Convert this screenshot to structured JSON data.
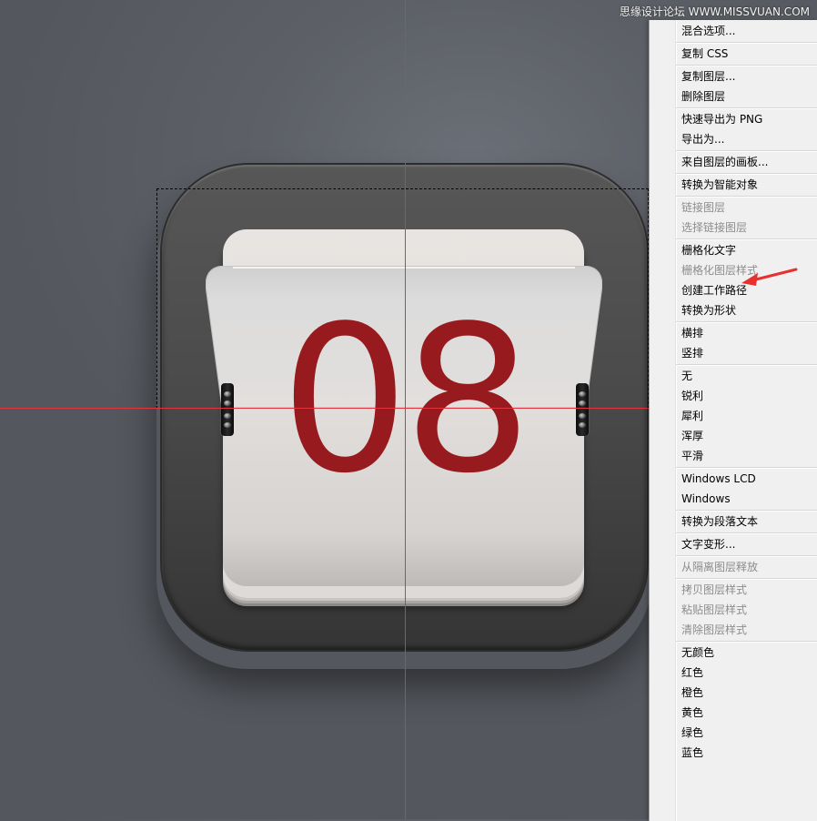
{
  "watermark": "思缘设计论坛 WWW.MISSVUAN.COM",
  "icon": {
    "digits": "08",
    "digit_color": "#971b1e"
  },
  "guides": {
    "color": "#e0343f"
  },
  "context_menu": {
    "groups": [
      [
        {
          "label": "混合选项...",
          "enabled": true
        }
      ],
      [
        {
          "label": "复制 CSS",
          "enabled": true
        }
      ],
      [
        {
          "label": "复制图层...",
          "enabled": true
        },
        {
          "label": "删除图层",
          "enabled": true
        }
      ],
      [
        {
          "label": "快速导出为 PNG",
          "enabled": true
        },
        {
          "label": "导出为...",
          "enabled": true
        }
      ],
      [
        {
          "label": "来自图层的画板...",
          "enabled": true
        }
      ],
      [
        {
          "label": "转换为智能对象",
          "enabled": true
        }
      ],
      [
        {
          "label": "链接图层",
          "enabled": false
        },
        {
          "label": "选择链接图层",
          "enabled": false
        }
      ],
      [
        {
          "label": "栅格化文字",
          "enabled": true
        },
        {
          "label": "栅格化图层样式",
          "enabled": false
        },
        {
          "label": "创建工作路径",
          "enabled": true
        },
        {
          "label": "转换为形状",
          "enabled": true
        }
      ],
      [
        {
          "label": "横排",
          "enabled": true
        },
        {
          "label": "竖排",
          "enabled": true
        }
      ],
      [
        {
          "label": "无",
          "enabled": true
        },
        {
          "label": "锐利",
          "enabled": true
        },
        {
          "label": "犀利",
          "enabled": true
        },
        {
          "label": "浑厚",
          "enabled": true
        },
        {
          "label": "平滑",
          "enabled": true
        }
      ],
      [
        {
          "label": "Windows LCD",
          "enabled": true
        },
        {
          "label": "Windows",
          "enabled": true
        }
      ],
      [
        {
          "label": "转换为段落文本",
          "enabled": true
        }
      ],
      [
        {
          "label": "文字变形...",
          "enabled": true
        }
      ],
      [
        {
          "label": "从隔离图层释放",
          "enabled": false
        }
      ],
      [
        {
          "label": "拷贝图层样式",
          "enabled": false
        },
        {
          "label": "粘贴图层样式",
          "enabled": false
        },
        {
          "label": "清除图层样式",
          "enabled": false
        }
      ],
      [
        {
          "label": "无颜色",
          "enabled": true
        },
        {
          "label": "红色",
          "enabled": true
        },
        {
          "label": "橙色",
          "enabled": true
        },
        {
          "label": "黄色",
          "enabled": true
        },
        {
          "label": "绿色",
          "enabled": true
        },
        {
          "label": "蓝色",
          "enabled": true
        }
      ]
    ]
  },
  "annotation": {
    "arrow_color": "#e8312f",
    "points_to": "栅格化文字"
  }
}
